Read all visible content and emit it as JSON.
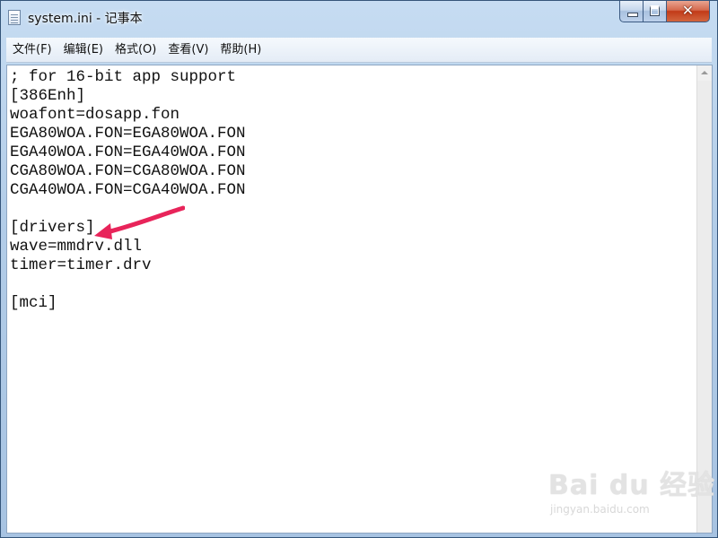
{
  "window": {
    "title": "system.ini - 记事本"
  },
  "caption_buttons": {
    "close_glyph": "✕"
  },
  "menu": {
    "items": [
      "文件(F)",
      "编辑(E)",
      "格式(O)",
      "查看(V)",
      "帮助(H)"
    ]
  },
  "editor": {
    "lines": [
      "; for 16-bit app support",
      "[386Enh]",
      "woafont=dosapp.fon",
      "EGA80WOA.FON=EGA80WOA.FON",
      "EGA40WOA.FON=EGA40WOA.FON",
      "CGA80WOA.FON=CGA80WOA.FON",
      "CGA40WOA.FON=CGA40WOA.FON",
      "",
      "[drivers]",
      "wave=mmdrv.dll",
      "timer=timer.drv",
      "",
      "[mci]"
    ]
  },
  "annotation": {
    "arrow_color": "#e8245a"
  },
  "watermark": {
    "logo": "Bai du 经验",
    "url": "jingyan.baidu.com"
  }
}
